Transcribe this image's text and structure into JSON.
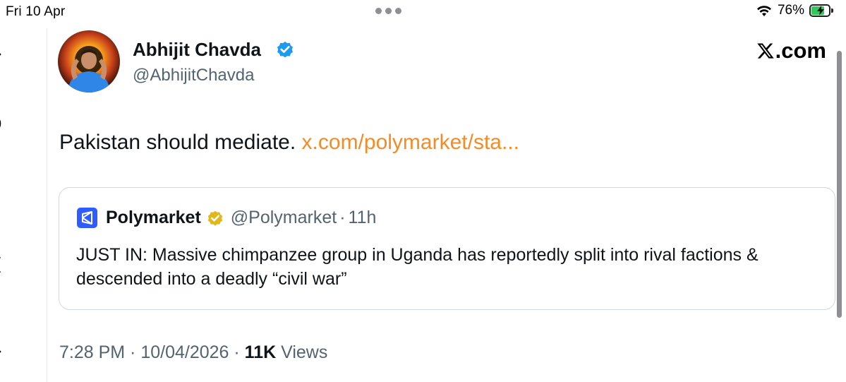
{
  "status_bar": {
    "time": "Fri 10 Apr",
    "battery_percent": "76%",
    "battery_level": 0.76
  },
  "tweet": {
    "author_name": "Abhijit Chavda",
    "author_handle": "@AbhijitChavda",
    "text": "Pakistan should mediate.",
    "link_text": "x.com/polymarket/sta...",
    "timestamp": "7:28 PM · 10/04/2026 · ",
    "views_count": "11K",
    "views_label": " Views"
  },
  "brand": {
    "label": ".com",
    "icon": "x-logo-icon"
  },
  "quoted_tweet": {
    "name": "Polymarket",
    "handle": "@Polymarket",
    "separator": "·",
    "time": "11h",
    "text": "JUST IN: Massive chimpanzee group in Uganda has reportedly split into rival factions & descended into a deadly “civil war”"
  },
  "colors": {
    "link": "#f28c28",
    "verified_blue": "#1d9bf0",
    "verified_gold": "#e2b719",
    "polymarket_blue": "#2e5cff",
    "secondary_text": "#536471"
  }
}
